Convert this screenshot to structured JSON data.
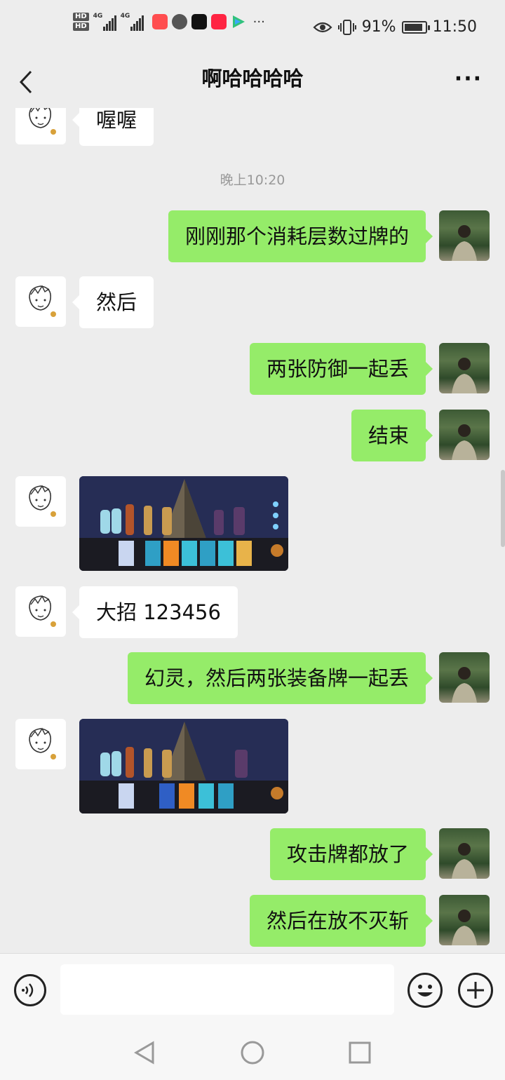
{
  "status_bar": {
    "hd1": "HD",
    "hd2": "HD",
    "net1": "4G",
    "net2": "4G",
    "more": "···",
    "battery_level": 91,
    "battery_text": "91%",
    "time": "11:50"
  },
  "header": {
    "title": "啊哈哈哈哈",
    "more": "···"
  },
  "messages": [
    {
      "sender": "friend",
      "text": "喔喔"
    },
    {
      "type": "timestamp",
      "text": "晚上10:20"
    },
    {
      "sender": "me",
      "text": "刚刚那个消耗层数过牌的"
    },
    {
      "sender": "friend",
      "text": "然后"
    },
    {
      "sender": "me",
      "text": "两张防御一起丢"
    },
    {
      "sender": "me",
      "text": "结束"
    },
    {
      "sender": "friend",
      "type": "image"
    },
    {
      "sender": "friend",
      "text": "大招 123456"
    },
    {
      "sender": "me",
      "text": "幻灵，然后两张装备牌一起丢"
    },
    {
      "sender": "friend",
      "type": "image"
    },
    {
      "sender": "me",
      "text": "攻击牌都放了"
    },
    {
      "sender": "me",
      "text": "然后在放不灭斩"
    }
  ],
  "input": {
    "value": "",
    "placeholder": ""
  },
  "colors": {
    "outgoing_bubble": "#95ec69",
    "incoming_bubble": "#ffffff",
    "background": "#ededed"
  }
}
